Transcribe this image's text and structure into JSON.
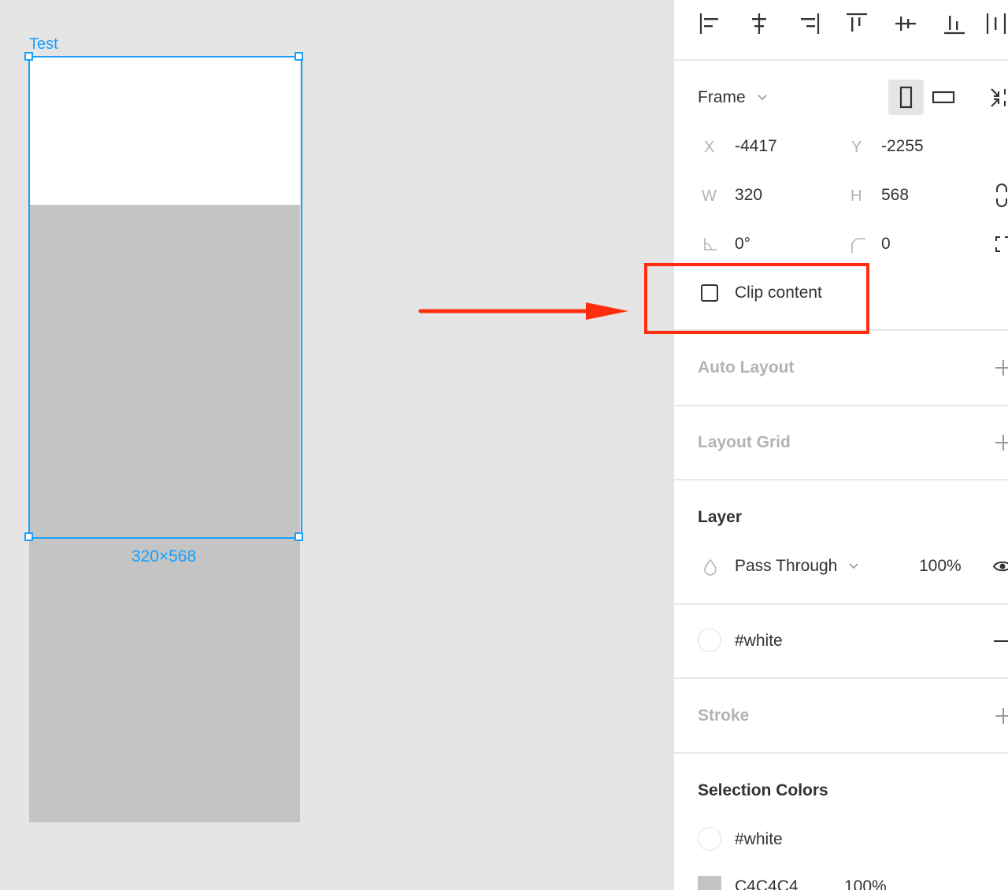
{
  "canvas": {
    "frame_name": "Test",
    "frame_size": "320×568"
  },
  "panel": {
    "frame_section": {
      "type_label": "Frame",
      "x_label": "X",
      "x_value": "-4417",
      "y_label": "Y",
      "y_value": "-2255",
      "w_label": "W",
      "w_value": "320",
      "h_label": "H",
      "h_value": "568",
      "rotation_value": "0°",
      "radius_value": "0",
      "clip_content_label": "Clip content",
      "clip_content_checked": false
    },
    "auto_layout": {
      "title": "Auto Layout"
    },
    "layout_grid": {
      "title": "Layout Grid"
    },
    "layer": {
      "title": "Layer",
      "blend_mode": "Pass Through",
      "opacity": "100%"
    },
    "fill": {
      "value": "#white"
    },
    "stroke": {
      "title": "Stroke"
    },
    "selection_colors": {
      "title": "Selection Colors",
      "items": [
        {
          "name": "#white",
          "opacity": ""
        },
        {
          "name": "C4C4C4",
          "opacity": "100%"
        }
      ]
    }
  },
  "colors": {
    "selection": "#18a0fb",
    "highlight": "#ff2d0d",
    "canvas_bg": "#e5e5e5",
    "grey_fill": "#c4c4c4"
  }
}
